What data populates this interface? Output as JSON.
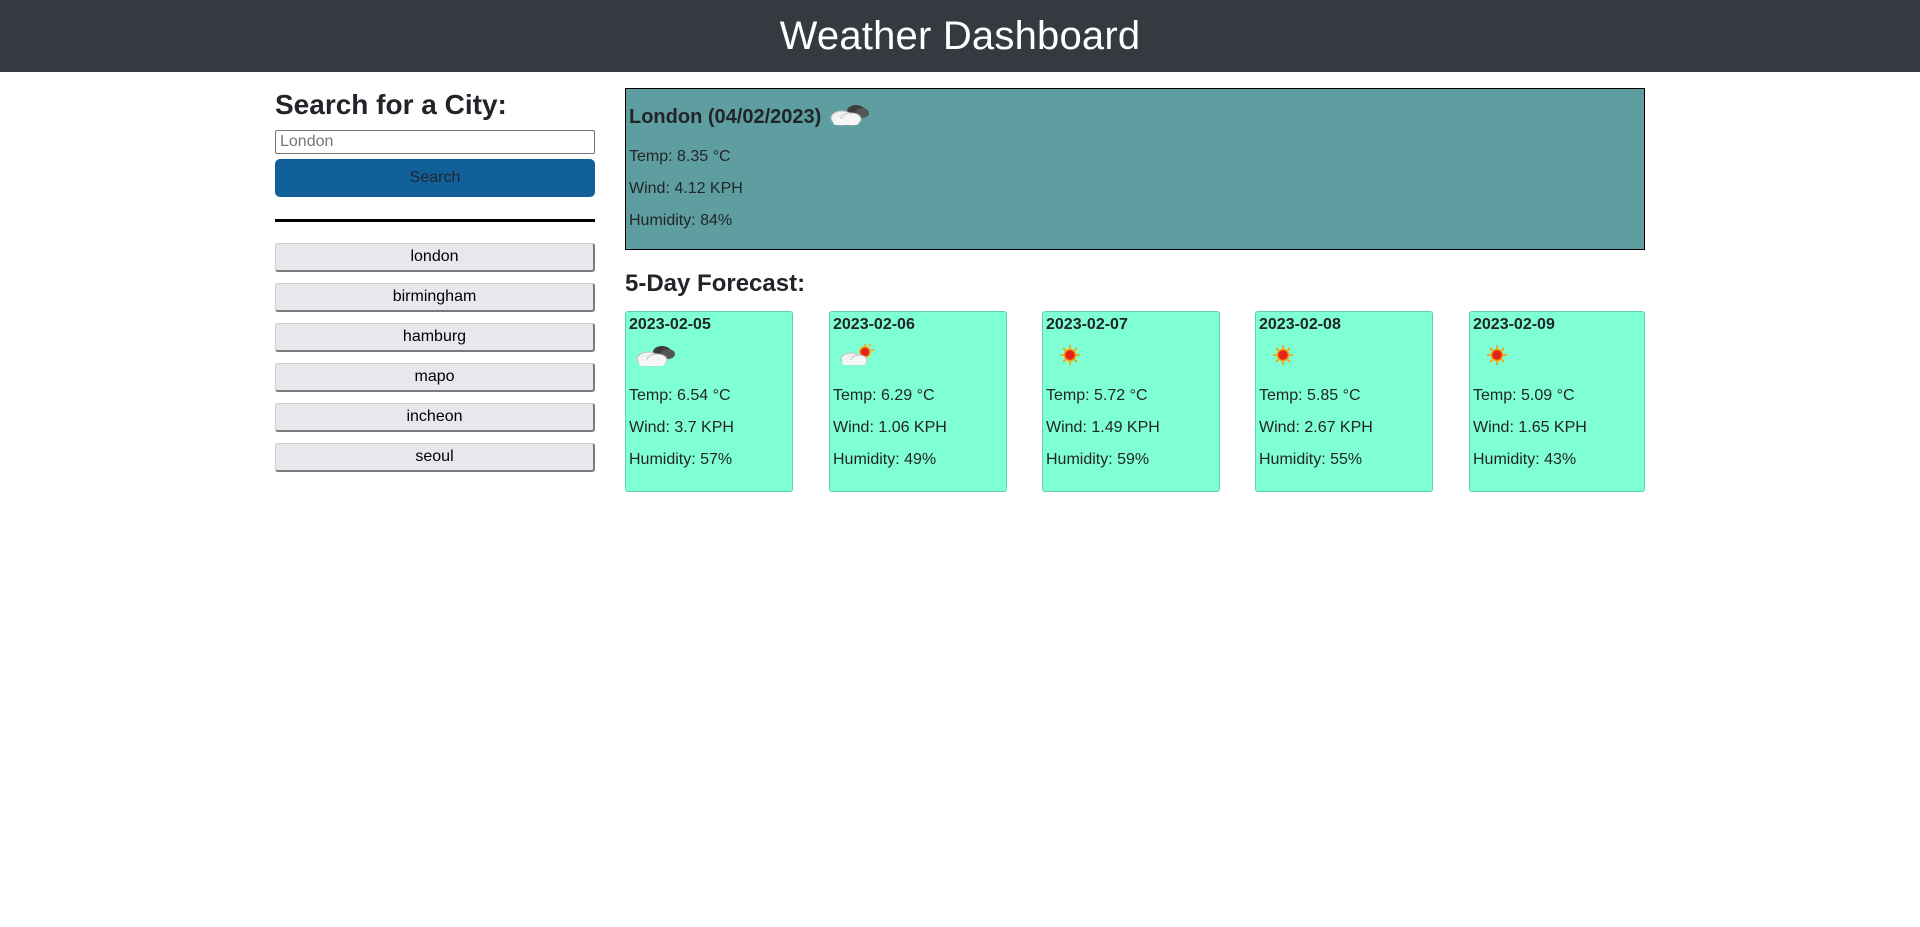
{
  "header": {
    "title": "Weather Dashboard"
  },
  "search": {
    "heading": "Search for a City:",
    "placeholder": "London",
    "button_label": "Search"
  },
  "history": [
    {
      "label": "london"
    },
    {
      "label": "birmingham"
    },
    {
      "label": "hamburg"
    },
    {
      "label": "mapo"
    },
    {
      "label": "incheon"
    },
    {
      "label": "seoul"
    }
  ],
  "current": {
    "title": "London (04/02/2023)",
    "icon": "broken-clouds-icon",
    "temp": "Temp: 8.35 °C",
    "wind": "Wind: 4.12 KPH",
    "humidity": "Humidity: 84%"
  },
  "forecast": {
    "heading": "5-Day Forecast:",
    "days": [
      {
        "date": "2023-02-05",
        "icon": "broken-clouds-icon",
        "temp": "Temp: 6.54 °C",
        "wind": "Wind: 3.7 KPH",
        "humidity": "Humidity: 57%"
      },
      {
        "date": "2023-02-06",
        "icon": "few-clouds-icon",
        "temp": "Temp: 6.29 °C",
        "wind": "Wind: 1.06 KPH",
        "humidity": "Humidity: 49%"
      },
      {
        "date": "2023-02-07",
        "icon": "clear-sky-icon",
        "temp": "Temp: 5.72 °C",
        "wind": "Wind: 1.49 KPH",
        "humidity": "Humidity: 59%"
      },
      {
        "date": "2023-02-08",
        "icon": "clear-sky-icon",
        "temp": "Temp: 5.85 °C",
        "wind": "Wind: 2.67 KPH",
        "humidity": "Humidity: 55%"
      },
      {
        "date": "2023-02-09",
        "icon": "clear-sky-icon",
        "temp": "Temp: 5.09 °C",
        "wind": "Wind: 1.65 KPH",
        "humidity": "Humidity: 43%"
      }
    ]
  },
  "colors": {
    "topbar": "#343a40",
    "search_button": "#11609a",
    "current_bg": "#5f9ea0",
    "forecast_card_bg": "#7fffd4"
  }
}
